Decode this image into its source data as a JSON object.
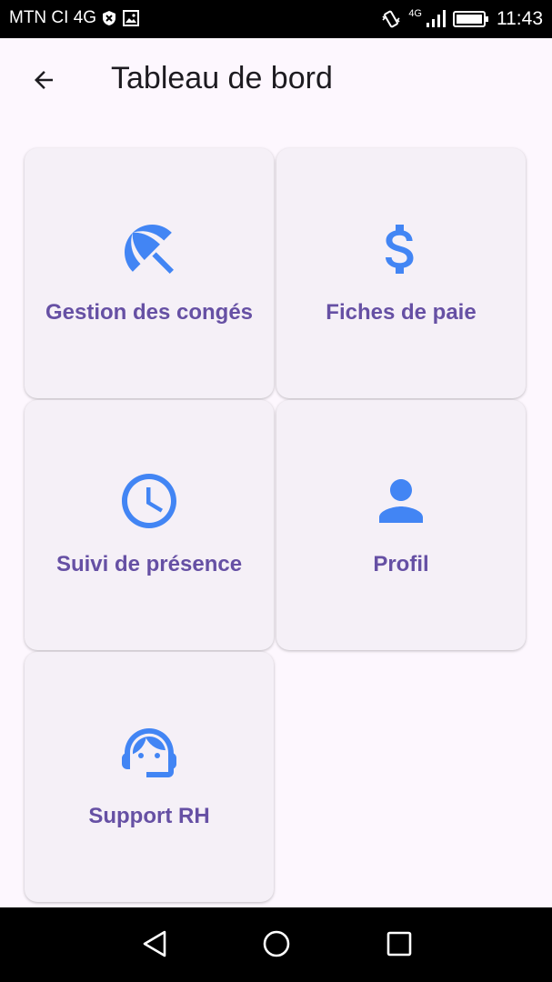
{
  "status_bar": {
    "carrier": "MTN CI 4G",
    "network_type": "4G",
    "time": "11:43",
    "icons": [
      "shield-icon",
      "image-icon",
      "vibrate-icon",
      "signal-icon",
      "battery-icon"
    ]
  },
  "app_bar": {
    "title": "Tableau de bord",
    "back_icon": "arrow-back-icon"
  },
  "accent_color": "#4285f4",
  "label_color": "#6650a4",
  "cards": [
    {
      "label": "Gestion des congés",
      "icon": "beach-umbrella-icon"
    },
    {
      "label": "Fiches de paie",
      "icon": "dollar-icon"
    },
    {
      "label": "Suivi de présence",
      "icon": "clock-icon"
    },
    {
      "label": "Profil",
      "icon": "person-icon"
    },
    {
      "label": "Support RH",
      "icon": "support-agent-icon"
    }
  ],
  "nav_bar": {
    "buttons": [
      "back-triangle-icon",
      "home-circle-icon",
      "recents-square-icon"
    ]
  }
}
